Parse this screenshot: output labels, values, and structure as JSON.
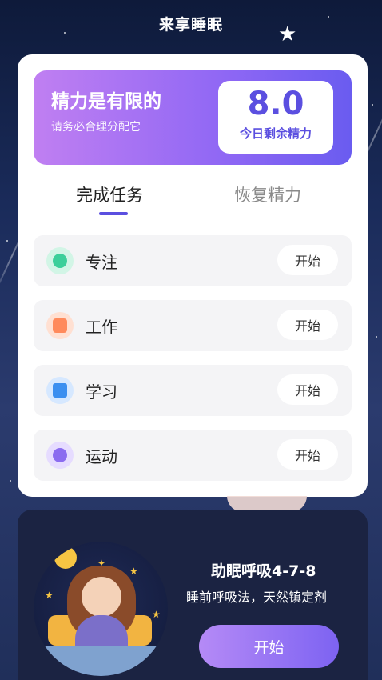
{
  "app": {
    "title": "来享睡眠"
  },
  "energy": {
    "title": "精力是有限的",
    "subtitle": "请务必合理分配它",
    "value": "8.0",
    "value_label": "今日剩余精力"
  },
  "tabs": [
    {
      "label": "完成任务",
      "active": true
    },
    {
      "label": "恢复精力",
      "active": false
    }
  ],
  "tasks": [
    {
      "label": "专注",
      "button": "开始",
      "icon": "focus-icon",
      "color": "#3ccf9a"
    },
    {
      "label": "工作",
      "button": "开始",
      "icon": "briefcase-icon",
      "color": "#ff8a5c"
    },
    {
      "label": "学习",
      "button": "开始",
      "icon": "book-icon",
      "color": "#3b8ff0"
    },
    {
      "label": "运动",
      "button": "开始",
      "icon": "ball-icon",
      "color": "#8b6cf0"
    }
  ],
  "breathing": {
    "title": "助眠呼吸4-7-8",
    "subtitle": "睡前呼吸法，天然镇定剂",
    "button": "开始"
  },
  "colors": {
    "accent": "#5b4fe0",
    "banner_start": "#c07ff2",
    "banner_end": "#6a5cf0"
  }
}
